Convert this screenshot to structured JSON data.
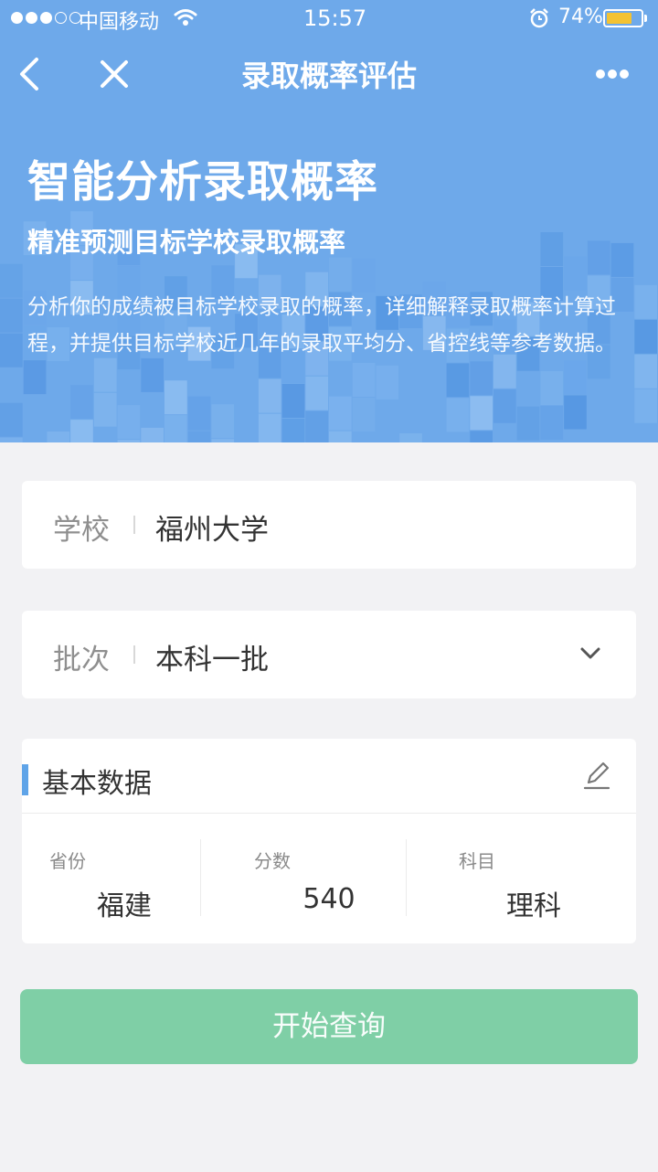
{
  "status_bar": {
    "carrier": "中国移动",
    "time": "15:57",
    "battery": "74%",
    "battery_level": 0.74,
    "signal_filled": 3,
    "signal_total": 5,
    "battery_color": "#f3c232"
  },
  "nav": {
    "title": "录取概率评估",
    "back_icon": "chevron-left-icon",
    "close_icon": "close-icon",
    "more_icon": "more-dots-icon"
  },
  "hero": {
    "title": "智能分析录取概率",
    "subtitle": "精准预测目标学校录取概率",
    "description": "分析你的成绩被目标学校录取的概率，详细解释录取概率计算过程，并提供目标学校近几年的录取平均分、省控线等参考数据。",
    "background_color": "#6ea9ea"
  },
  "form": {
    "school": {
      "label": "学校",
      "value": "福州大学"
    },
    "batch": {
      "label": "批次",
      "value": "本科一批"
    }
  },
  "basic_data": {
    "title": "基本数据",
    "accent_color": "#5fa4e8",
    "columns": [
      {
        "label": "省份",
        "value": "福建"
      },
      {
        "label": "分数",
        "value": "540"
      },
      {
        "label": "科目",
        "value": "理科"
      }
    ]
  },
  "query_button": {
    "label": "开始查询",
    "color": "#7fcfa6"
  }
}
